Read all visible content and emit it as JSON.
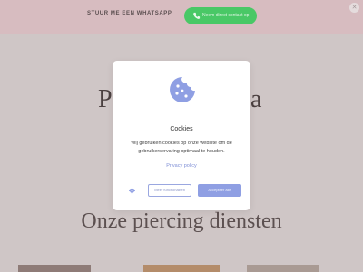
{
  "topbar": {
    "text": "STUUR ME EEN WHATSAPP",
    "whatsapp_label": "Neem direct contact op"
  },
  "hero": {
    "title_left": "P",
    "title_right": "a"
  },
  "section": {
    "title": "Onze piercing diensten"
  },
  "cookie_modal": {
    "title": "Cookies",
    "body": "Wij gebruiken cookies op onze website om de gebruikerservaring optimaal te houden.",
    "privacy_link": "Privacy policy",
    "more_button": "Meer functionaliteit",
    "accept_button": "Accepteer alle"
  },
  "colors": {
    "accent": "#8f9fe3",
    "whatsapp": "#49c866",
    "topbar": "#d7bcc0"
  },
  "icons": {
    "cookie": "cookie-icon",
    "whatsapp": "phone-icon",
    "settings": "gear-icon",
    "close": "close-icon"
  }
}
